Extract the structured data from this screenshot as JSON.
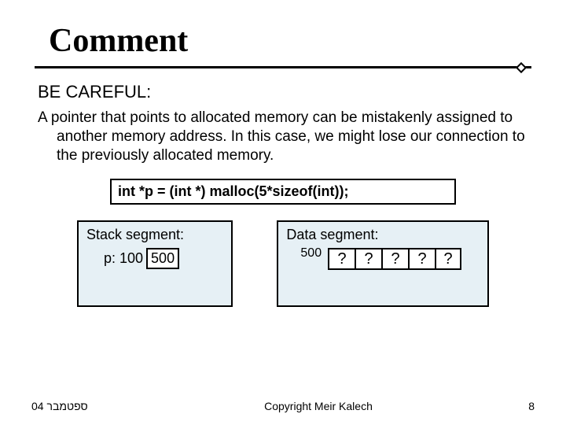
{
  "title": "Comment",
  "careful": "BE CAREFUL:",
  "paragraph": "A pointer that points to allocated memory can be mistakenly assigned to another memory address. In this case, we might lose our connection to the previously allocated memory.",
  "code": "int *p = (int *) malloc(5*sizeof(int));",
  "stack": {
    "title": "Stack segment:",
    "label": "p: 100",
    "value": "500"
  },
  "data": {
    "title": "Data segment:",
    "address": "500",
    "cells": [
      "?",
      "?",
      "?",
      "?",
      "?"
    ]
  },
  "footer": {
    "left": "ספטמבר 04",
    "center": "Copyright Meir Kalech",
    "right": "8"
  }
}
